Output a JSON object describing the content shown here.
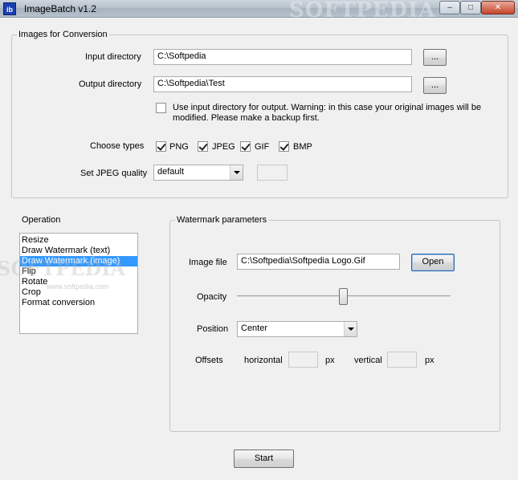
{
  "window": {
    "icon_text": "ib",
    "title": "ImageBatch v1.2",
    "watermark": "SOFTPEDIA",
    "minimize": "–",
    "maximize": "□",
    "close": "✕"
  },
  "conversion": {
    "legend": "Images for Conversion",
    "input_label": "Input directory",
    "input_value": "C:\\Softpedia",
    "output_label": "Output directory",
    "output_value": "C:\\Softpedia\\Test",
    "browse_label": "...",
    "use_input_text_line1": "Use input directory for output. Warning: in this case your original images will be",
    "use_input_text_line2": "modified. Please make a backup first.",
    "choose_types_label": "Choose types",
    "types": [
      {
        "label": "PNG",
        "checked": true
      },
      {
        "label": "JPEG",
        "checked": true
      },
      {
        "label": "GIF",
        "checked": true
      },
      {
        "label": "BMP",
        "checked": true
      }
    ],
    "jpeg_quality_label": "Set JPEG quality",
    "jpeg_quality_value": "default"
  },
  "operation": {
    "label": "Operation",
    "items": [
      "Resize",
      "Draw Watermark (text)",
      "Draw Watermark (image)",
      "Flip",
      "Rotate",
      "Crop",
      "Format conversion"
    ],
    "selected_index": 2
  },
  "watermark": {
    "legend": "Watermark parameters",
    "image_file_label": "Image file",
    "image_file_value": "C:\\Softpedia\\Softpedia Logo.Gif",
    "open_label": "Open",
    "opacity_label": "Opacity",
    "opacity_fraction": 0.5,
    "position_label": "Position",
    "position_value": "Center",
    "offsets_label": "Offsets",
    "horizontal_label": "horizontal",
    "vertical_label": "vertical",
    "px_label": "px"
  },
  "start_label": "Start",
  "side_watermark": "SOFTPEDIA",
  "side_watermark_small": "www.softpedia.com"
}
